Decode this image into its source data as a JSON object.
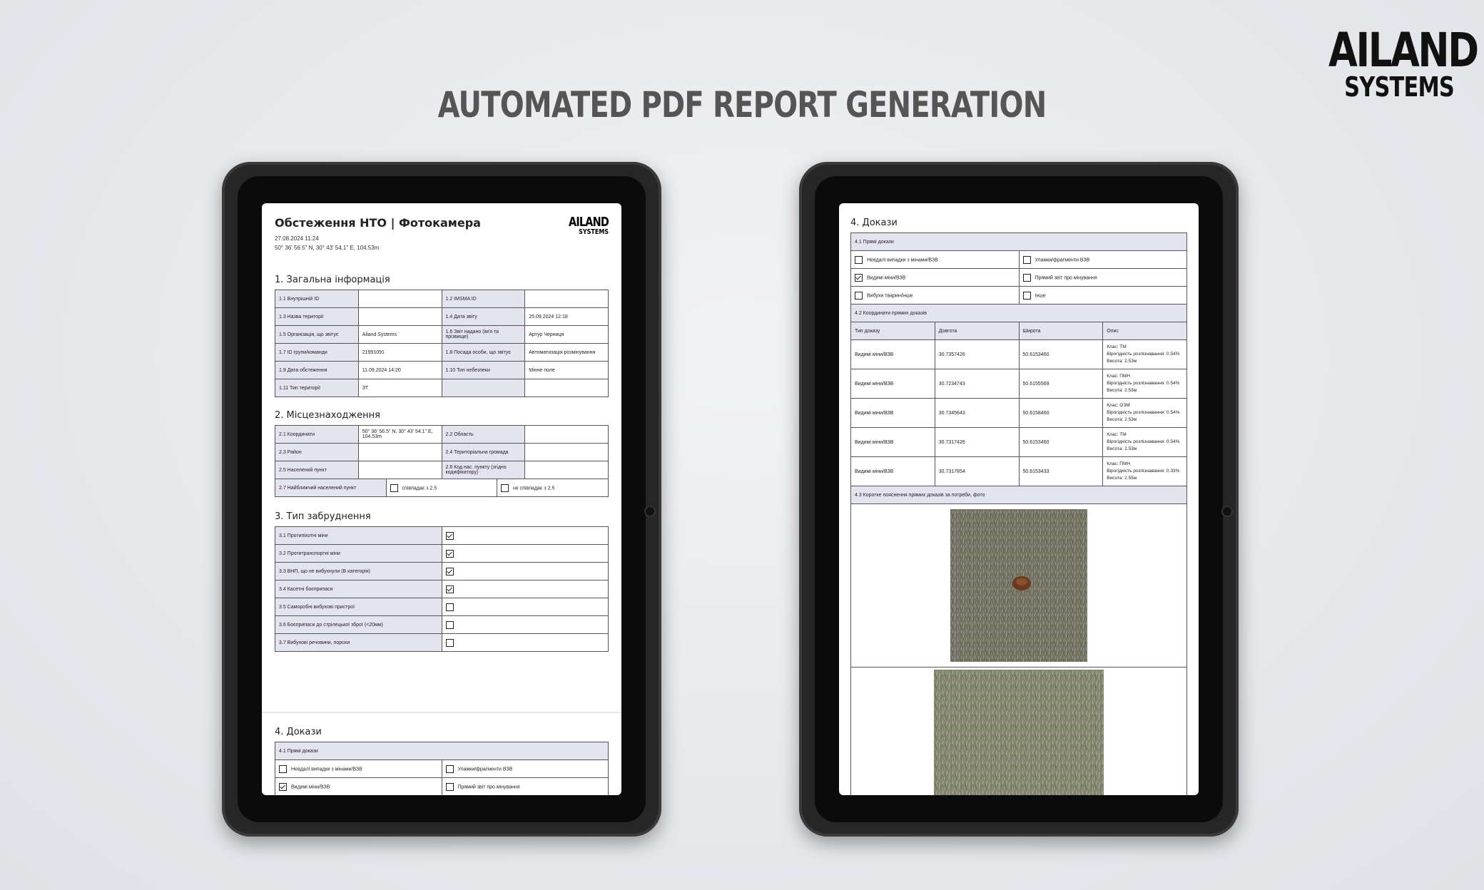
{
  "brand": {
    "line1": "AILAND",
    "line2": "SYSTEMS"
  },
  "headline": "AUTOMATED PDF REPORT GENERATION",
  "left": {
    "title": "Обстеження НТО | Фотокамера",
    "date": "27.08.2024 11:24",
    "coords": "50° 36' 56.5\" N, 30° 43' 54.1\" E, 104.53m",
    "logo1": "AILAND",
    "logo2": "SYSTEMS",
    "s1": "1. Загальна інформація",
    "s1rows": [
      [
        "1.1 Внутрішній ID",
        "",
        "1.2 IMSMA ID",
        ""
      ],
      [
        "1.3 Назва території",
        "",
        "1.4 Дата звіту",
        "25.09.2024 12:18"
      ],
      [
        "1.5 Організація, що звітує",
        "Ailand Systems",
        "1.6 Звіт надано (ім'я та прізвище)",
        "Артур Черниця"
      ],
      [
        "1.7 ID групи/команди",
        "21991091",
        "1.8 Посада особи, що звітує",
        "Автоматизація розмінування"
      ],
      [
        "1.9 Дата обстеження",
        "11.09.2024 14:20",
        "1.10 Тип небезпеки",
        "Мінне поле"
      ],
      [
        "1.11 Тип території",
        "ЗТ",
        "",
        ""
      ]
    ],
    "s2": "2. Місцезнаходження",
    "s2rows": [
      [
        "2.1 Координати",
        "50° 36' 56.5\" N, 30° 43' 54.1\" E, 104.53m",
        "2.2 Область",
        ""
      ],
      [
        "2.3 Район",
        "",
        "2.4 Територіальна громада",
        ""
      ],
      [
        "2.5 Населений пункт",
        "",
        "2.6 Код нас. пункту (згідно кодифікатору)",
        ""
      ]
    ],
    "s2last": {
      "label": "2.7 Найближчий населений пункт",
      "opt1": "співпадає з 2.5",
      "opt2": "не співпадає з 2.5"
    },
    "s3": "3. Тип забруднення",
    "s3rows": [
      {
        "label": "3.1 Протипіхотні міни",
        "checked": true
      },
      {
        "label": "3.2 Протитранспортні міни",
        "checked": true
      },
      {
        "label": "3.3 ВНП, що не вибухнули (В категорія)",
        "checked": true
      },
      {
        "label": "3.4 Касетні боєприпаси",
        "checked": true
      },
      {
        "label": "3.5 Саморобні вибухові пристрої",
        "checked": false
      },
      {
        "label": "3.6 Боєприпаси до стрілецької зброї (<20мм)",
        "checked": false
      },
      {
        "label": "3.7 Вибухові речовини, порохи",
        "checked": false
      }
    ],
    "s4": "4. Докази",
    "s4head": "4.1 Прямі докази",
    "s4rows": [
      [
        {
          "label": "Невдалі випадки з мінами/ВЗВ",
          "checked": false
        },
        {
          "label": "Уламки/фрагменти ВЗВ",
          "checked": false
        }
      ],
      [
        {
          "label": "Видимі міни/ВЗВ",
          "checked": true
        },
        {
          "label": "Прямий звіт про мінування",
          "checked": false
        }
      ]
    ]
  },
  "right": {
    "s4": "4. Докази",
    "h41": "4.1 Прямі докази",
    "rows41": [
      [
        {
          "label": "Невдалі випадки з мінами/ВЗВ",
          "checked": false
        },
        {
          "label": "Уламки/фрагменти ВЗВ",
          "checked": false
        }
      ],
      [
        {
          "label": "Видимі міни/ВЗВ",
          "checked": true
        },
        {
          "label": "Прямий звіт про мінування",
          "checked": false
        }
      ],
      [
        {
          "label": "Вибухи тварин/інше",
          "checked": false
        },
        {
          "label": "Інше",
          "checked": false
        }
      ]
    ],
    "h42": "4.2 Координати прямих доказів",
    "cols42": [
      "Тип доказу",
      "Довгота",
      "Широта",
      "Опис"
    ],
    "rows42": [
      {
        "type": "Видимі міни/ВЗВ",
        "lon": "30.7357426",
        "lat": "50.6153460",
        "d1": "Клас: TM",
        "d2": "Вірогідність розпізнавання: 0.54%",
        "d3": "Висота: 2.53м"
      },
      {
        "type": "Видимі міни/ВЗВ",
        "lon": "30.7234743",
        "lat": "50.6155569",
        "d1": "Клас: ПМН",
        "d2": "Вірогідність розпізнавання: 0.54%",
        "d3": "Висота: 2.53м"
      },
      {
        "type": "Видимі міни/ВЗВ",
        "lon": "30.7345643",
        "lat": "50.6158460",
        "d1": "Клас: ОЗМ",
        "d2": "Вірогідність розпізнавання: 0.54%",
        "d3": "Висота: 2.53м"
      },
      {
        "type": "Видимі міни/ВЗВ",
        "lon": "30.7317426",
        "lat": "50.6153460",
        "d1": "Клас: TM",
        "d2": "Вірогідність розпізнавання: 0.54%",
        "d3": "Висота: 2.53м"
      },
      {
        "type": "Видимі міни/ВЗВ",
        "lon": "30.7317854",
        "lat": "50.6153433",
        "d1": "Клас: ПМН",
        "d2": "Вірогідність розпізнавання: 0.33%",
        "d3": "Висота: 2.55м"
      }
    ],
    "h43": "4.3 Коротке пояснення прямих доказів за потреби, фото"
  }
}
